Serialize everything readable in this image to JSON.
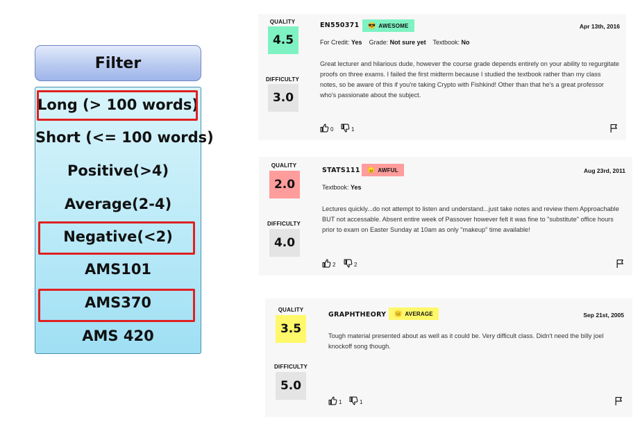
{
  "filter": {
    "title": "Filter",
    "options": [
      "Long (> 100 words)",
      "Short (<= 100 words)",
      "Positive(>4)",
      "Average(2-4)",
      "Negative(<2)",
      "AMS101",
      "AMS370",
      "AMS 420"
    ],
    "highlighted": [
      "Long (> 100 words)",
      "Negative(<2)",
      "AMS370"
    ]
  },
  "labels": {
    "quality": "QUALITY",
    "difficulty": "DIFFICULTY"
  },
  "reviews": [
    {
      "quality": "4.5",
      "quality_color": "#7ef2c2",
      "difficulty": "3.0",
      "course": "EN550371",
      "tag": "AWESOME",
      "tag_emoji": "😎",
      "tag_color": "#7ef2c2",
      "date": "Apr 13th, 2016",
      "meta": {
        "credit_label": "For Credit:",
        "credit": "Yes",
        "grade_label": "Grade:",
        "grade": "Not sure yet",
        "textbook_label": "Textbook:",
        "textbook": "No"
      },
      "text": "Great lecturer and hilarious dude, however the course grade depends entirely on your ability to regurgitate proofs on three exams. I failed the first midterm because I studied the textbook rather than my class notes, so be aware of this if you're taking Crypto with Fishkind! Other than that he's a great professor who's passionate about the subject.",
      "thumbs_up": "0",
      "thumbs_down": "1"
    },
    {
      "quality": "2.0",
      "quality_color": "#ff9c9c",
      "difficulty": "4.0",
      "course": "STATS111",
      "tag": "AWFUL",
      "tag_emoji": "😠",
      "tag_color": "#ff9c9c",
      "date": "Aug 23rd, 2011",
      "meta": {
        "textbook_label": "Textbook:",
        "textbook": "Yes"
      },
      "text": "Lectures quickly...do not attempt to listen and understand...just take notes and review them Approachable BUT not accessable. Absent entire week of Passover however felt it was fine to \"substitute\" office hours prior to exam on Easter Sunday at 10am as only \"makeup\" time available!",
      "thumbs_up": "2",
      "thumbs_down": "2"
    },
    {
      "quality": "3.5",
      "quality_color": "#fff86a",
      "difficulty": "5.0",
      "course": "GRAPHTHEORY",
      "tag": "AVERAGE",
      "tag_emoji": "😐",
      "tag_color": "#fff86a",
      "date": "Sep 21st, 2005",
      "text": "Tough material presented about as well as it could be. Very difficult class. Didn't need the billy joel knockoff song though.",
      "thumbs_up": "1",
      "thumbs_down": "1"
    }
  ],
  "colors": {
    "difficulty_bg": "#e4e4e4",
    "highlight_border": "#e02020"
  },
  "icons": {
    "up": "thumbs-up-icon",
    "down": "thumbs-down-icon",
    "flag": "flag-icon"
  }
}
